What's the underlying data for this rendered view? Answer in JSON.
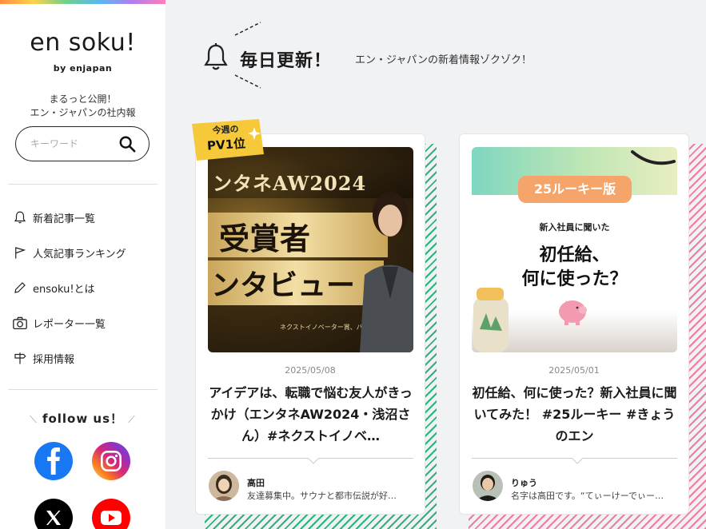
{
  "sidebar": {
    "logo": "en soku!",
    "logo_sub": "by enjapan",
    "tagline_1": "まるっと公開！",
    "tagline_2": "エン・ジャパンの社内報",
    "search_placeholder": "キーワード",
    "nav": [
      {
        "label": "新着記事一覧",
        "icon": "bell-icon"
      },
      {
        "label": "人気記事ランキング",
        "icon": "flag-icon"
      },
      {
        "label": "ensoku!とは",
        "icon": "pencil-icon"
      },
      {
        "label": "レポーター一覧",
        "icon": "camera-icon"
      },
      {
        "label": "採用情報",
        "icon": "signpost-icon"
      }
    ],
    "follow_label": "follow us！",
    "social": [
      "facebook-icon",
      "instagram-icon",
      "x-icon",
      "youtube-icon"
    ]
  },
  "main": {
    "section_title": "毎日更新！",
    "section_sub": "エン・ジャパンの新着情報ゾクゾク！",
    "badge_line1": "今週の",
    "badge_line2": "PV1位",
    "cards": [
      {
        "thumb_line1": "ンタネAW2024",
        "thumb_line2": "受賞者",
        "thumb_line3": "ンタビュー",
        "thumb_caption": "ネクストイノベーター賞、パーパス賞",
        "date": "2025/05/08",
        "title": "アイデアは、転職で悩む友人がきっかけ（エンタネAW2024・浅沼さん）#ネクストイノベ…",
        "author": "高田",
        "bio": "友達募集中。サウナと都市伝説が好…",
        "stripe_color": "#2db37a"
      },
      {
        "thumb_tag": "25ルーキー版",
        "thumb_line1": "新入社員に聞いた",
        "thumb_line2": "初任給、",
        "thumb_line3": "何に使った？",
        "date": "2025/05/01",
        "title": "初任給、何に使った？新入社員に聞いてみた！ #25ルーキー #きょうのエン",
        "author": "りゅう",
        "bio": "名字は高田です。“てぃーけーでぃー…",
        "stripe_color": "#f07aa2"
      }
    ]
  }
}
